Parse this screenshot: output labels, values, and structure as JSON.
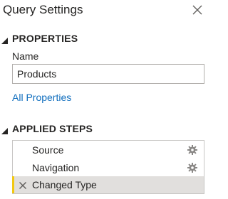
{
  "pane": {
    "title": "Query Settings",
    "close_icon": "close-icon"
  },
  "properties": {
    "header": "PROPERTIES",
    "name_label": "Name",
    "name_value": "Products",
    "all_properties_link": "All Properties"
  },
  "applied_steps": {
    "header": "APPLIED STEPS",
    "steps": [
      {
        "label": "Source",
        "has_settings": true,
        "selected": false
      },
      {
        "label": "Navigation",
        "has_settings": true,
        "selected": false
      },
      {
        "label": "Changed Type",
        "has_settings": false,
        "selected": true
      }
    ]
  },
  "colors": {
    "link": "#106ebe",
    "selected_row": "#e1dfdd",
    "selected_accent": "#f2c811",
    "gear": "#8a8886"
  }
}
